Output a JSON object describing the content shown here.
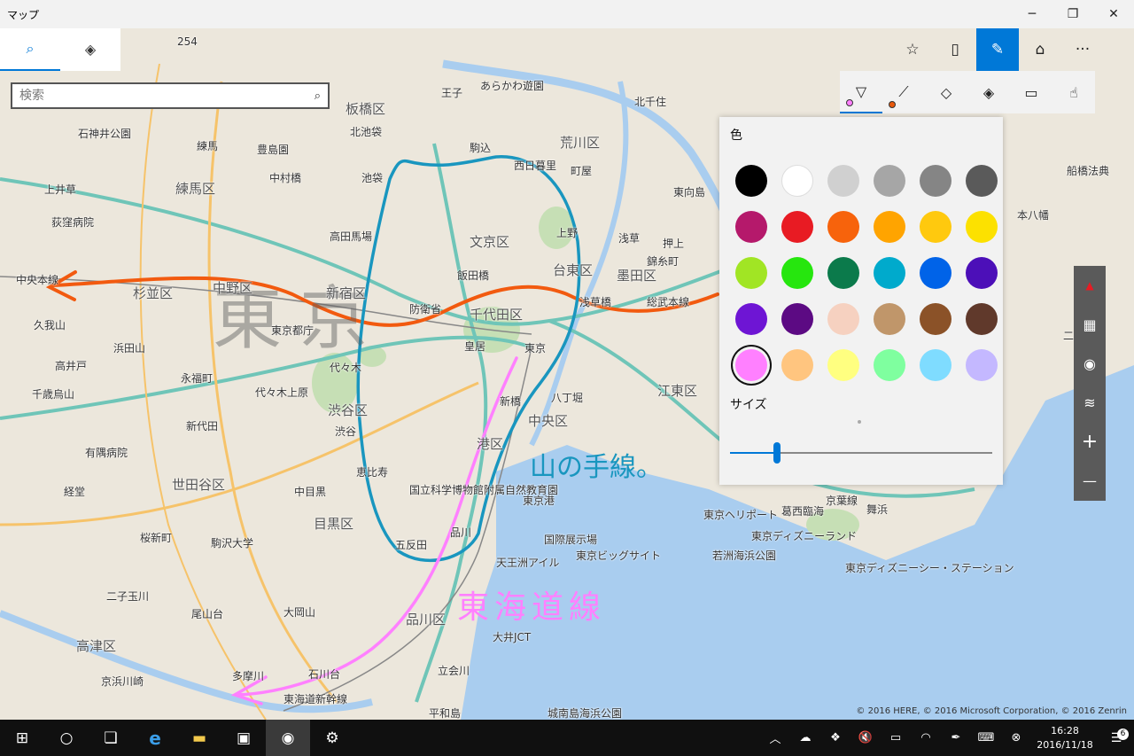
{
  "window": {
    "title": "マップ",
    "minimize_icon": "─",
    "restore_icon": "❐",
    "close_icon": "✕"
  },
  "search": {
    "placeholder": "検索",
    "tab_search_icon": "⌕",
    "tab_directions_icon": "◈",
    "search_icon": "⌕"
  },
  "toolbar": {
    "favorites_icon": "☆",
    "traffic_icon": "▯",
    "ink_icon": "✎",
    "3d_icon": "⌂",
    "more_icon": "···"
  },
  "ink": {
    "pen_icon": "▽",
    "pen_dot_color": "#ff80ff",
    "line_icon": "⟋",
    "line_dot_color": "#e8590c",
    "eraser_icon": "◇",
    "directions_icon": "◈",
    "ruler_icon": "▭",
    "touch_icon": "☝"
  },
  "flyout": {
    "color_label": "色",
    "size_label": "サイズ",
    "size_value": 0.18,
    "selected_index": 24,
    "colors": [
      "#000000",
      "#ffffff",
      "#d0d0d0",
      "#a6a6a6",
      "#858585",
      "#5a5a5a",
      "#b5196b",
      "#e81b23",
      "#f7630c",
      "#ffa400",
      "#ffc90e",
      "#fce100",
      "#a1e524",
      "#26e60e",
      "#0b7a4b",
      "#00aacc",
      "#0063e8",
      "#4c0fb8",
      "#6e15d4",
      "#5c0a83",
      "#f6d1c0",
      "#c0966a",
      "#8b5228",
      "#60392b",
      "#ff80ff",
      "#ffc57f",
      "#ffff80",
      "#7fff9f",
      "#7fdcff",
      "#c4b8ff"
    ]
  },
  "side": {
    "compass_icon": "▲",
    "aerial_icon": "▦",
    "location_icon": "◉",
    "layers_icon": "≋",
    "zoom_in_icon": "+",
    "zoom_out_icon": "—"
  },
  "map": {
    "big_label": "東京",
    "labels": [
      {
        "t": "254",
        "c": "shield"
      },
      {
        "t": "板橋区",
        "c": "ward"
      },
      {
        "t": "北池袋"
      },
      {
        "t": "練馬区",
        "c": "ward"
      },
      {
        "t": "石神井公園"
      },
      {
        "t": "練馬"
      },
      {
        "t": "上井草"
      },
      {
        "t": "荻窪病院"
      },
      {
        "t": "中央本線"
      },
      {
        "t": "杉並区",
        "c": "ward"
      },
      {
        "t": "中野区",
        "c": "ward"
      },
      {
        "t": "新宿区",
        "c": "ward"
      },
      {
        "t": "文京区",
        "c": "ward"
      },
      {
        "t": "荒川区",
        "c": "ward"
      },
      {
        "t": "台東区",
        "c": "ward"
      },
      {
        "t": "墨田区",
        "c": "ward"
      },
      {
        "t": "千代田区",
        "c": "ward"
      },
      {
        "t": "渋谷区",
        "c": "ward"
      },
      {
        "t": "中央区",
        "c": "ward"
      },
      {
        "t": "江東区",
        "c": "ward"
      },
      {
        "t": "港区",
        "c": "ward"
      },
      {
        "t": "世田谷区",
        "c": "ward"
      },
      {
        "t": "目黒区",
        "c": "ward"
      },
      {
        "t": "品川区",
        "c": "ward"
      },
      {
        "t": "高津区",
        "c": "ward"
      },
      {
        "t": "池袋"
      },
      {
        "t": "高田馬場"
      },
      {
        "t": "飯田橋"
      },
      {
        "t": "上野"
      },
      {
        "t": "浅草"
      },
      {
        "t": "東京"
      },
      {
        "t": "皇居"
      },
      {
        "t": "防衛省"
      },
      {
        "t": "東京都庁"
      },
      {
        "t": "代々木"
      },
      {
        "t": "代々木上原"
      },
      {
        "t": "渋谷"
      },
      {
        "t": "恵比寿"
      },
      {
        "t": "中目黒"
      },
      {
        "t": "五反田"
      },
      {
        "t": "品川"
      },
      {
        "t": "新橋"
      },
      {
        "t": "八丁堀"
      },
      {
        "t": "東京港"
      },
      {
        "t": "東京ヘリポート"
      },
      {
        "t": "東京ディズニーランド"
      },
      {
        "t": "若洲海浜公園"
      },
      {
        "t": "東京ディズニーシー・ステーション"
      },
      {
        "t": "国際展示場"
      },
      {
        "t": "東京ビッグサイト"
      },
      {
        "t": "天王洲アイル"
      },
      {
        "t": "大井JCT"
      },
      {
        "t": "平和島"
      },
      {
        "t": "城南島海浜公園"
      },
      {
        "t": "二子玉川"
      },
      {
        "t": "尾山台"
      },
      {
        "t": "大岡山"
      },
      {
        "t": "石川台"
      },
      {
        "t": "立会川"
      },
      {
        "t": "京浜川崎"
      },
      {
        "t": "多摩川"
      },
      {
        "t": "東海道新幹線"
      },
      {
        "t": "浜田山"
      },
      {
        "t": "久我山"
      },
      {
        "t": "高井戸"
      },
      {
        "t": "千歳烏山"
      },
      {
        "t": "永福町"
      },
      {
        "t": "新代田"
      },
      {
        "t": "有隅病院"
      },
      {
        "t": "経堂"
      },
      {
        "t": "桜新町"
      },
      {
        "t": "駒沢大学"
      },
      {
        "t": "豊島園"
      },
      {
        "t": "中村橋"
      },
      {
        "t": "北千住"
      },
      {
        "t": "町屋"
      },
      {
        "t": "西日暮里"
      },
      {
        "t": "駒込"
      },
      {
        "t": "王子"
      },
      {
        "t": "あらかわ遊園"
      },
      {
        "t": "東向島"
      },
      {
        "t": "押上"
      },
      {
        "t": "錦糸町"
      },
      {
        "t": "船橋法典"
      },
      {
        "t": "本八幡"
      },
      {
        "t": "国立科学博物館附属自然教育園"
      },
      {
        "t": "総武本線"
      },
      {
        "t": "浅草橋"
      },
      {
        "t": "京葉線"
      },
      {
        "t": "舞浜"
      },
      {
        "t": "二俣新町"
      },
      {
        "t": "葛西臨海"
      }
    ],
    "ink_yamanote": "山の手線。",
    "ink_tokaido": "東海道線",
    "copyright": "© 2016 HERE, © 2016 Microsoft Corporation, © 2016 Zenrin"
  },
  "taskbar": {
    "start_icon": "⊞",
    "cortana_icon": "○",
    "taskview_icon": "❏",
    "edge_icon": "e",
    "explorer_icon": "▬",
    "store_icon": "▣",
    "maps_icon": "◉",
    "settings_icon": "⚙",
    "tray_up_icon": "︿",
    "onedrive_icon": "☁",
    "dropbox_icon": "❖",
    "volume_icon": "🔇",
    "battery_icon": "▭",
    "wifi_icon": "◠",
    "pen_icon": "✒",
    "keyboard_icon": "⌨",
    "close_icon": "⊗",
    "time": "16:28",
    "date": "2016/11/18",
    "notif_icon": "☰",
    "notif_count": "6"
  }
}
